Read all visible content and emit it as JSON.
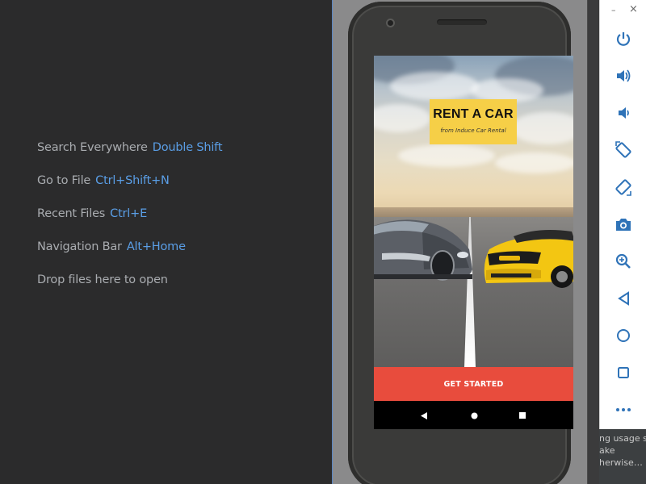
{
  "ide_hints": [
    {
      "label": "Search Everywhere",
      "shortcut": "Double Shift"
    },
    {
      "label": "Go to File",
      "shortcut": "Ctrl+Shift+N"
    },
    {
      "label": "Recent Files",
      "shortcut": "Ctrl+E"
    },
    {
      "label": "Navigation Bar",
      "shortcut": "Alt+Home"
    },
    {
      "label": "Drop files here to open",
      "shortcut": ""
    }
  ],
  "app": {
    "title": "RENT A CAR",
    "subtitle": "from Induce Car Rental",
    "cta_label": "GET STARTED"
  },
  "emulator_window": {
    "minimize": "–",
    "close": "×"
  },
  "toolbar_icons": [
    "power-icon",
    "volume-up-icon",
    "volume-down-icon",
    "rotate-left-icon",
    "rotate-right-icon",
    "camera-icon",
    "zoom-icon",
    "back-icon",
    "home-icon",
    "overview-icon",
    "more-icon"
  ],
  "notification_lines": [
    "ng usage s",
    "ake",
    "herwise…"
  ],
  "colors": {
    "ide_bg": "#2b2b2c",
    "shortcut": "#5a9ee6",
    "cta": "#e84c3d",
    "title_card": "#f6cf47",
    "toolbar_icon": "#2f73b8"
  }
}
